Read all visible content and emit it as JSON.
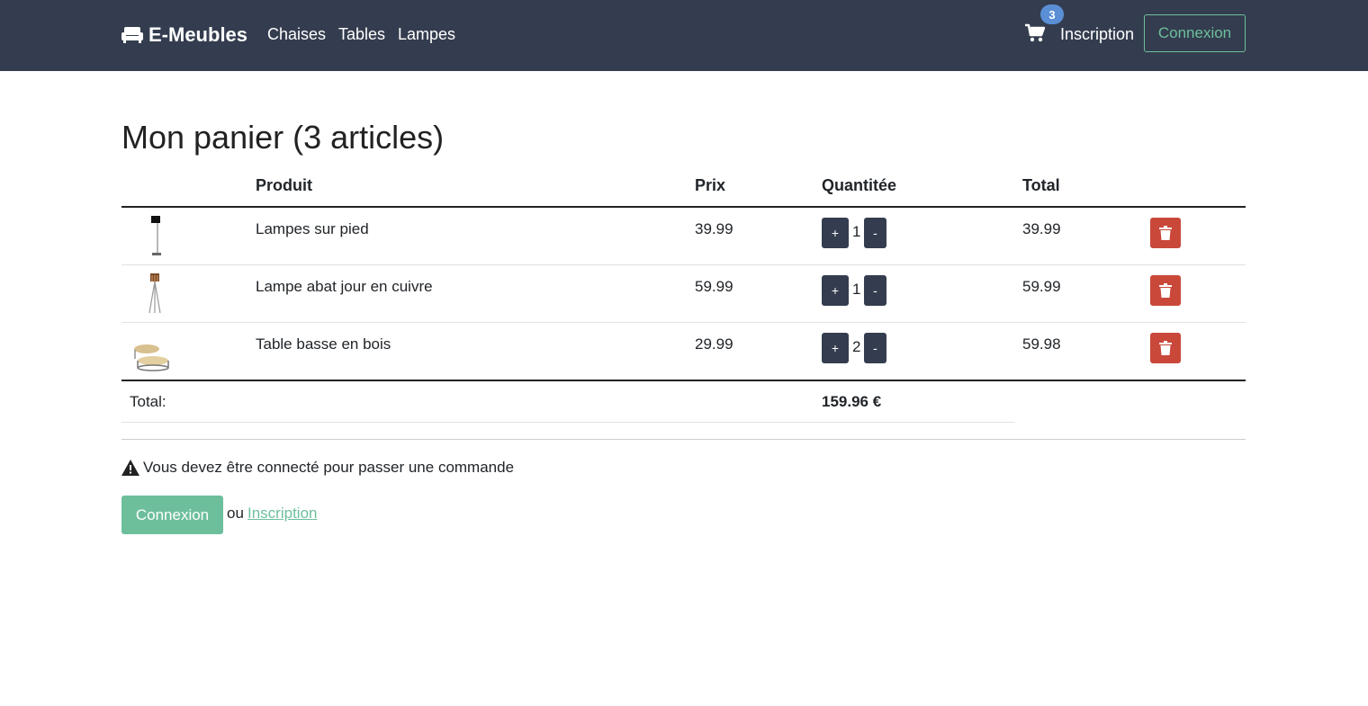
{
  "brand": {
    "name": "E-Meubles",
    "icon": "couch-icon"
  },
  "nav": {
    "links": [
      "Chaises",
      "Tables",
      "Lampes"
    ],
    "cart_count": "3",
    "inscription": "Inscription",
    "connexion": "Connexion"
  },
  "page": {
    "title": "Mon panier (3 articles)"
  },
  "table": {
    "headers": [
      "Produit",
      "Prix",
      "Quantitée",
      "Total"
    ],
    "rows": [
      {
        "product": "Lampes sur pied",
        "price": "39.99",
        "qty": "1",
        "total": "39.99",
        "thumb": "floor-lamp-black"
      },
      {
        "product": "Lampe abat jour en cuivre",
        "price": "59.99",
        "qty": "1",
        "total": "59.99",
        "thumb": "tripod-lamp-copper"
      },
      {
        "product": "Table basse en bois",
        "price": "29.99",
        "qty": "2",
        "total": "59.98",
        "thumb": "coffee-table-wood"
      }
    ],
    "plus_label": "+",
    "minus_label": "-",
    "total_label": "Total:",
    "total_amount": "159.96 €"
  },
  "checkout": {
    "warning": "Vous devez être connecté pour passer une commande",
    "login_button": "Connexion",
    "or_text": "ou",
    "register_link": "Inscription"
  },
  "colors": {
    "navbar": "#343d4f",
    "accent": "#6dbf9c",
    "danger": "#c9483a",
    "badge": "#5a8fd6"
  }
}
